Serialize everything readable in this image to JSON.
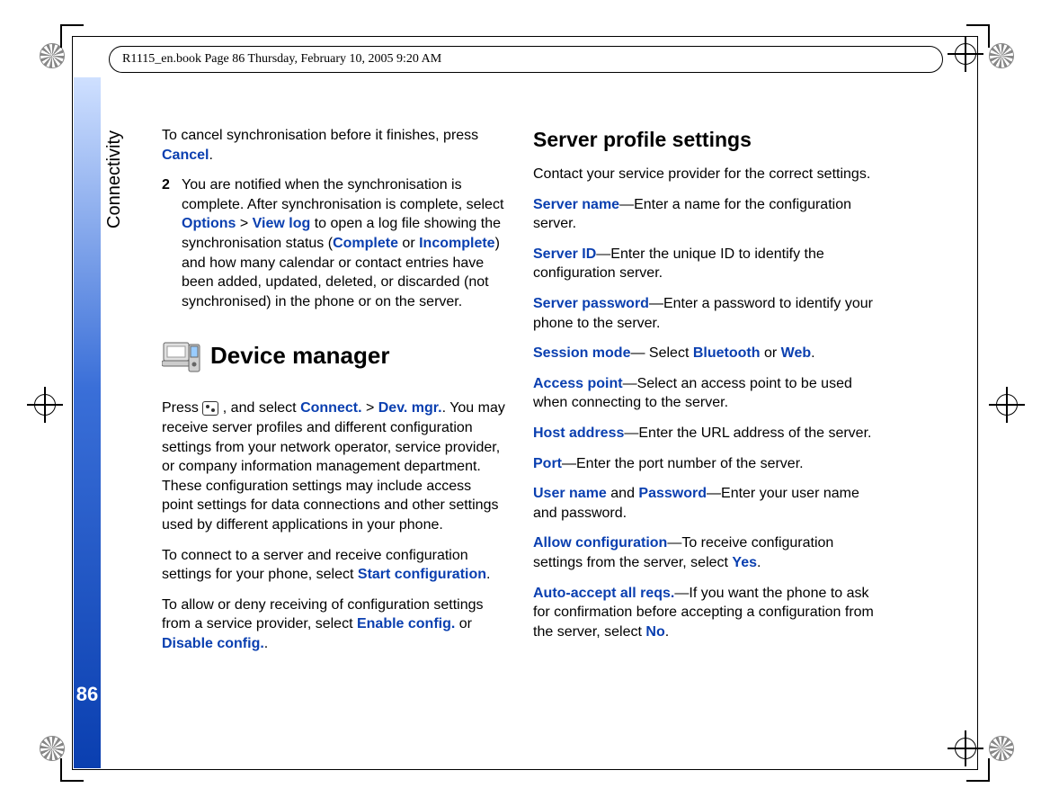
{
  "header": "R1115_en.book  Page 86  Thursday, February 10, 2005  9:20 AM",
  "sidebar_label": "Connectivity",
  "page_number": "86",
  "left": {
    "sync_cancel_pre": "To cancel synchronisation before it finishes, press ",
    "sync_cancel_term": "Cancel",
    "sync_cancel_post": ".",
    "step_num": "2",
    "step_a": "You are notified when the synchronisation is complete. After synchronisation is complete, select ",
    "step_options": "Options",
    "step_gt1": " > ",
    "step_viewlog": "View log",
    "step_b": " to open a log file showing the synchronisation status (",
    "step_complete": "Complete",
    "step_or": " or ",
    "step_incomplete": "Incomplete",
    "step_c": ") and how many calendar or contact entries have been added, updated, deleted, or discarded (not synchronised) in the phone or on the server.",
    "dm_heading": "Device manager",
    "dm_p1_a": "Press ",
    "dm_p1_b": " , and select ",
    "dm_connect": "Connect.",
    "dm_gt": " > ",
    "dm_devmgr": "Dev. mgr.",
    "dm_p1_c": ". You may receive server profiles and different configuration settings from your network operator, service provider, or company information management department. These configuration settings may include access point settings for data connections and other settings used by different applications in your phone.",
    "dm_p2_a": "To connect to a server and receive configuration settings for your phone, select ",
    "dm_startconfig": "Start configuration",
    "dm_p2_b": ".",
    "dm_p3_a": "To allow or deny receiving of configuration settings from a service provider, select ",
    "dm_enable": "Enable config.",
    "dm_p3_or": " or ",
    "dm_disable": "Disable config.",
    "dm_p3_b": "."
  },
  "right": {
    "h3": "Server profile settings",
    "intro": "Contact your service provider for the correct settings.",
    "srv_name_t": "Server name",
    "srv_name_d": "—Enter a name for the configuration server.",
    "srv_id_t": "Server ID",
    "srv_id_d": "—Enter the unique ID to identify the configuration server.",
    "srv_pw_t": "Server password",
    "srv_pw_d": "—Enter a password to identify your phone to the server.",
    "sess_t": "Session mode",
    "sess_d_a": "— Select ",
    "sess_bt": "Bluetooth",
    "sess_or": " or ",
    "sess_web": "Web",
    "sess_d_b": ".",
    "ap_t": "Access point",
    "ap_d": "—Select an access point to be used when connecting to the server.",
    "host_t": "Host address",
    "host_d": "—Enter the URL address of the server.",
    "port_t": "Port",
    "port_d": "—Enter the port number of the server.",
    "un_t": "User name",
    "un_and": " and ",
    "pw_t": "Password",
    "un_d": "—Enter your user name and password.",
    "allow_t": "Allow configuration",
    "allow_d_a": "—To receive configuration settings from the server, select ",
    "allow_yes": "Yes",
    "allow_d_b": ".",
    "auto_t": "Auto-accept all reqs.",
    "auto_d_a": "—If you want the phone to ask for confirmation before accepting a configuration from the server, select ",
    "auto_no": "No",
    "auto_d_b": "."
  }
}
